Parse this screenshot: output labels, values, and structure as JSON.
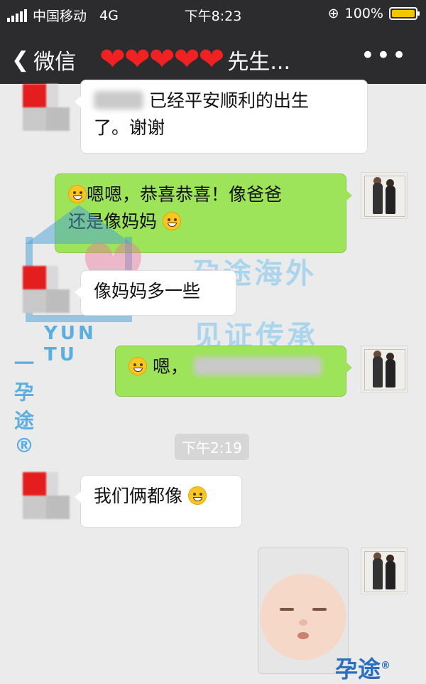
{
  "status_bar": {
    "carrier": "中国移动",
    "network": "4G",
    "time": "下午8:23",
    "battery": "100%",
    "battery_level": 1.0
  },
  "nav": {
    "back_label": "微信",
    "contact_name_suffix": "先生...",
    "more_label": "•••"
  },
  "messages": [
    {
      "side": "in",
      "text_line1": "已经平安顺利的出生",
      "text_line2": "了。谢谢"
    },
    {
      "side": "out",
      "text_line1": "嗯嗯，恭喜恭喜！像爸爸",
      "text_line2": "还是像妈妈"
    },
    {
      "side": "in",
      "text": "像妈妈多一些"
    },
    {
      "side": "out",
      "text": "嗯，"
    },
    {
      "side": "in",
      "text": "我们俩都像"
    }
  ],
  "timestamp": "下午2:19",
  "watermark": {
    "line1": "孕途海外",
    "line2": "见证传承",
    "brand_en": "YUN TU",
    "brand_cn": "一 孕途®",
    "corner_logo": "孕途"
  },
  "colors": {
    "outgoing_bubble": "#9de45a",
    "incoming_bubble": "#ffffff",
    "header_bg": "#2c2c2e",
    "chat_bg": "#ebebeb"
  }
}
